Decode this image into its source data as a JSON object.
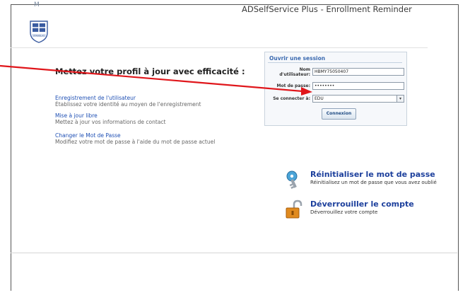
{
  "window": {
    "title": "ADSelfService Plus - Enrollment Reminder",
    "corner_mark": "M"
  },
  "logo": {
    "icon": "crest-icon",
    "caption": "STANISLAS"
  },
  "headline": "Mettez votre profil à jour avec efficacité :",
  "features": [
    {
      "title": "Enregistrement de l'utilisateur",
      "desc": "Établissez votre identité au moyen de l'enregistrement"
    },
    {
      "title": "Mise à jour libre",
      "desc": "Mettez à jour vos informations de contact"
    },
    {
      "title": "Changer le Mot de Passe",
      "desc": "Modifiez votre mot de passe à l'aide du mot de passe actuel"
    }
  ],
  "login": {
    "title": "Ouvrir une session",
    "username_label_1": "Nom",
    "username_label_2": "d'utilisateur:",
    "username_value": "HBMY75050407",
    "password_label": "Mot de passe:",
    "password_value": "••••••••",
    "domain_label": "Se connecter à:",
    "domain_value": "EDU",
    "submit_label": "Connexion"
  },
  "actions": [
    {
      "icon": "key-icon",
      "title": "Réinitialiser le mot de passe",
      "desc": "Réinitialisez un mot de passe que vous avez oublié"
    },
    {
      "icon": "unlock-icon",
      "title": "Déverrouiller le compte",
      "desc": "Déverrouillez votre compte"
    }
  ],
  "colors": {
    "link": "#1e4fb4",
    "action_title": "#1c3f9c",
    "annotation_arrow": "#e0161b"
  }
}
